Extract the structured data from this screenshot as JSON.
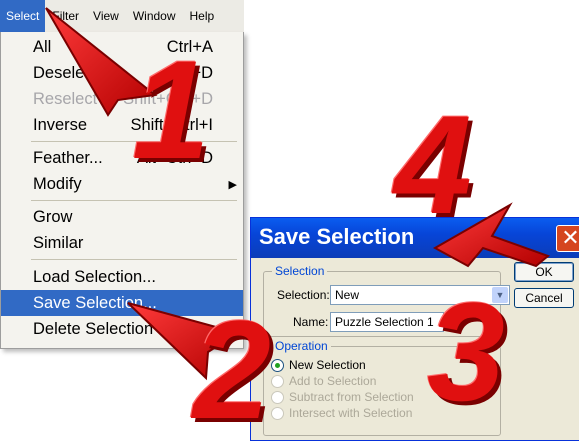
{
  "menubar": {
    "items": [
      "Select",
      "Filter",
      "View",
      "Window",
      "Help"
    ],
    "active_index": 0
  },
  "menu": {
    "items": [
      {
        "label": "All",
        "shortcut": "Ctrl+A"
      },
      {
        "label": "Deselect",
        "shortcut": "Ctrl+D"
      },
      {
        "label": "Reselect",
        "shortcut": "Shift+Ctrl+D",
        "disabled": true
      },
      {
        "label": "Inverse",
        "shortcut": "Shift+Ctrl+I"
      },
      {
        "label": "Feather...",
        "shortcut": "Alt+Ctrl+D"
      },
      {
        "label": "Modify",
        "submenu": true
      },
      {
        "label": "Grow"
      },
      {
        "label": "Similar"
      },
      {
        "label": "Load Selection..."
      },
      {
        "label": "Save Selection...",
        "highlighted": true
      },
      {
        "label": "Delete Selection"
      }
    ]
  },
  "dialog": {
    "title": "Save Selection",
    "close_glyph": "✕",
    "selection_group": {
      "legend": "Selection",
      "selection_label": "Selection:",
      "selection_value": "New",
      "name_label": "Name:",
      "name_value": "Puzzle Selection 1"
    },
    "operation_group": {
      "legend": "Operation",
      "options": [
        {
          "label": "New Selection",
          "checked": true,
          "disabled": false
        },
        {
          "label": "Add to Selection",
          "checked": false,
          "disabled": true
        },
        {
          "label": "Subtract from Selection",
          "checked": false,
          "disabled": true
        },
        {
          "label": "Intersect with Selection",
          "checked": false,
          "disabled": true
        }
      ]
    },
    "buttons": {
      "ok": "OK",
      "cancel": "Cancel"
    }
  },
  "annotations": {
    "step1": "1",
    "step2": "2",
    "step3": "3",
    "step4": "4",
    "arrow_color": "#e01010"
  }
}
